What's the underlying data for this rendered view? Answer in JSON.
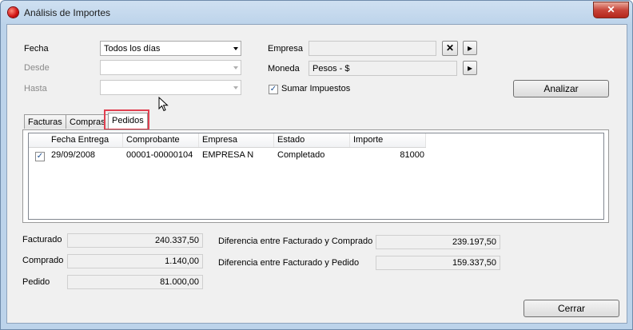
{
  "window": {
    "title": "Análisis de Importes",
    "close_glyph": "✕"
  },
  "filters": {
    "fecha_label": "Fecha",
    "fecha_value": "Todos los días",
    "desde_label": "Desde",
    "desde_value": "",
    "hasta_label": "Hasta",
    "hasta_value": "",
    "empresa_label": "Empresa",
    "empresa_value": "",
    "clear_glyph": "✕",
    "more_glyph": "▸",
    "moneda_label": "Moneda",
    "moneda_value": "Pesos - $",
    "sumar_label": "Sumar Impuestos",
    "sumar_checked": true,
    "analizar_label": "Analizar"
  },
  "tabs": [
    {
      "label": "Facturas",
      "active": false
    },
    {
      "label": "Compras",
      "active": false
    },
    {
      "label": "Pedidos",
      "active": true
    }
  ],
  "grid": {
    "columns": [
      "Fecha Entrega",
      "Comprobante",
      "Empresa",
      "Estado",
      "Importe"
    ],
    "rows": [
      {
        "checked": true,
        "cells": [
          "29/09/2008",
          "00001-00000104",
          "EMPRESA N",
          "Completado",
          "81000"
        ]
      }
    ]
  },
  "summary": {
    "facturado_label": "Facturado",
    "facturado_value": "240.337,50",
    "comprado_label": "Comprado",
    "comprado_value": "1.140,00",
    "pedido_label": "Pedido",
    "pedido_value": "81.000,00",
    "dif_fc_label": "Diferencia entre Facturado y Comprado",
    "dif_fc_value": "239.197,50",
    "dif_fp_label": "Diferencia entre Facturado y Pedido",
    "dif_fp_value": "159.337,50"
  },
  "footer": {
    "cerrar_label": "Cerrar"
  },
  "colors": {
    "highlight": "#e04050",
    "titlebar": "#bcd3ea",
    "close": "#c8453a"
  }
}
